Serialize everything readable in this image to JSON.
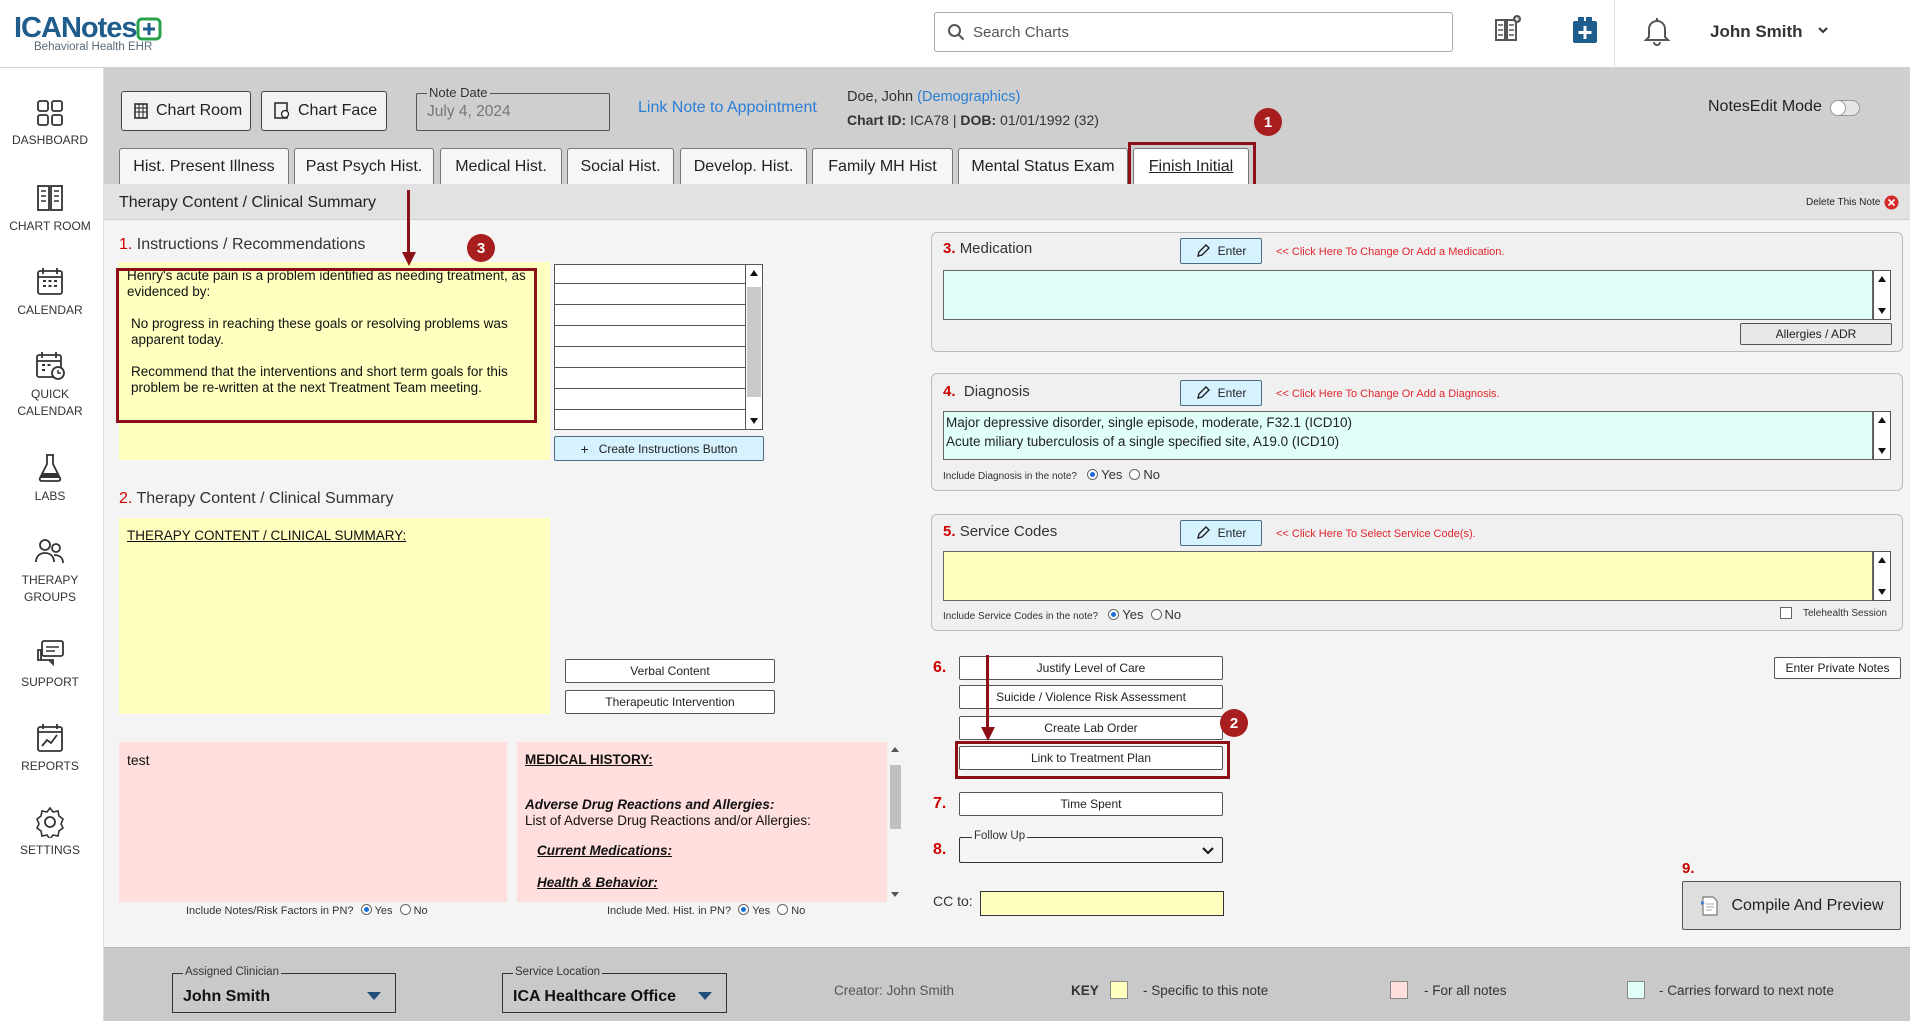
{
  "header": {
    "logo": "ICANotes",
    "logo_subtitle": "Behavioral Health EHR",
    "search_placeholder": "Search Charts",
    "user_name": "John Smith"
  },
  "sidebar": {
    "items": [
      {
        "label": "DASHBOARD",
        "icon": "dashboard-icon"
      },
      {
        "label": "CHART ROOM",
        "icon": "chart-room-icon"
      },
      {
        "label": "CALENDAR",
        "icon": "calendar-icon"
      },
      {
        "label1": "QUICK",
        "label2": "CALENDAR",
        "icon": "quick-calendar-icon"
      },
      {
        "label": "LABS",
        "icon": "flask-icon"
      },
      {
        "label1": "THERAPY",
        "label2": "GROUPS",
        "icon": "people-icon"
      },
      {
        "label": "SUPPORT",
        "icon": "support-chat-icon"
      },
      {
        "label": "REPORTS",
        "icon": "reports-icon"
      },
      {
        "label": "SETTINGS",
        "icon": "gear-icon"
      }
    ]
  },
  "toolbar": {
    "chart_room": "Chart Room",
    "chart_face": "Chart Face",
    "note_date_label": "Note Date",
    "note_date": "July 4, 2024",
    "link_note": "Link Note to Appointment",
    "patient_name": "Doe, John",
    "demographics": "(Demographics)",
    "chart_id_label": "Chart ID:",
    "chart_id": "ICA78",
    "dob_label": "DOB:",
    "dob": "01/01/1992 (32)",
    "notesedit": "NotesEdit Mode"
  },
  "tabs": [
    "Hist. Present Illness",
    "Past Psych Hist.",
    "Medical Hist.",
    "Social Hist.",
    "Develop. Hist.",
    "Family MH Hist",
    "Mental Status Exam",
    "Finish Initial"
  ],
  "panel": {
    "title": "Therapy Content / Clinical Summary",
    "delete_note": "Delete This Note"
  },
  "section1": {
    "num": "1.",
    "title": "Instructions / Recommendations",
    "p1": "Henry's acute pain is a problem identified as needing treatment, as evidenced by:",
    "p2": "No progress in reaching these goals or resolving problems was apparent today.",
    "p3": "Recommend that the interventions and short term goals for this problem be re-written at the next Treatment Team meeting.",
    "create_btn": "Create Instructions Button"
  },
  "section2": {
    "num": "2.",
    "title": "Therapy Content / Clinical Summary",
    "content": "THERAPY CONTENT / CLINICAL SUMMARY:",
    "verbal": "Verbal Content",
    "therapeutic": "Therapeutic Intervention"
  },
  "notes_box": {
    "text": "test",
    "include_label": "Include Notes/Risk Factors in PN?",
    "yes": "Yes",
    "no": "No"
  },
  "medhist_box": {
    "h1": "MEDICAL HISTORY:",
    "h2": "Adverse Drug Reactions and Allergies:",
    "t2": "List of Adverse Drug Reactions and/or Allergies:",
    "h3": "Current Medications:",
    "h4": "Health & Behavior:",
    "include_label": "Include Med. Hist. in PN?",
    "yes": "Yes",
    "no": "No"
  },
  "medication": {
    "num": "3.",
    "title": "Medication",
    "enter": "Enter",
    "hint": "<< Click Here To Change Or Add a Medication.",
    "allergies": "Allergies / ADR"
  },
  "diagnosis": {
    "num": "4.",
    "title": "Diagnosis",
    "enter": "Enter",
    "hint": "<< Click Here To Change Or Add a Diagnosis.",
    "line1": "Major depressive disorder, single episode, moderate, F32.1 (ICD10)",
    "line2": "Acute miliary tuberculosis of a single specified site, A19.0 (ICD10)",
    "include_label": "Include Diagnosis in the note?",
    "yes": "Yes",
    "no": "No"
  },
  "service": {
    "num": "5.",
    "title": "Service Codes",
    "enter": "Enter",
    "hint": "<< Click Here To Select Service Code(s).",
    "include_label": "Include Service Codes in the note?",
    "yes": "Yes",
    "no": "No",
    "telehealth": "Telehealth Session"
  },
  "actions": {
    "num6": "6.",
    "justify": "Justify Level of Care",
    "suicide": "Suicide / Violence Risk Assessment",
    "lab": "Create Lab Order",
    "link_tp": "Link to Treatment Plan",
    "num7": "7.",
    "time": "Time Spent",
    "num8": "8.",
    "follow_up": "Follow Up",
    "cc_to": "CC to:",
    "private_notes": "Enter Private Notes",
    "num9": "9.",
    "compile": "Compile And Preview"
  },
  "badges": [
    "1",
    "2",
    "3"
  ],
  "footer": {
    "clinician_label": "Assigned Clinician",
    "clinician": "John Smith",
    "location_label": "Service Location",
    "location": "ICA Healthcare Office",
    "creator": "Creator: John Smith",
    "key": "KEY",
    "key1": "- Specific to this note",
    "key2": "- For all notes",
    "key3": "- Carries forward to next note"
  },
  "colors": {
    "accent_red": "#8b1018",
    "hint_red": "#e0262e",
    "link_blue": "#2a7ed6",
    "yellow": "#ffffc0",
    "pink": "#ffdede",
    "mint": "#e0fff8"
  }
}
